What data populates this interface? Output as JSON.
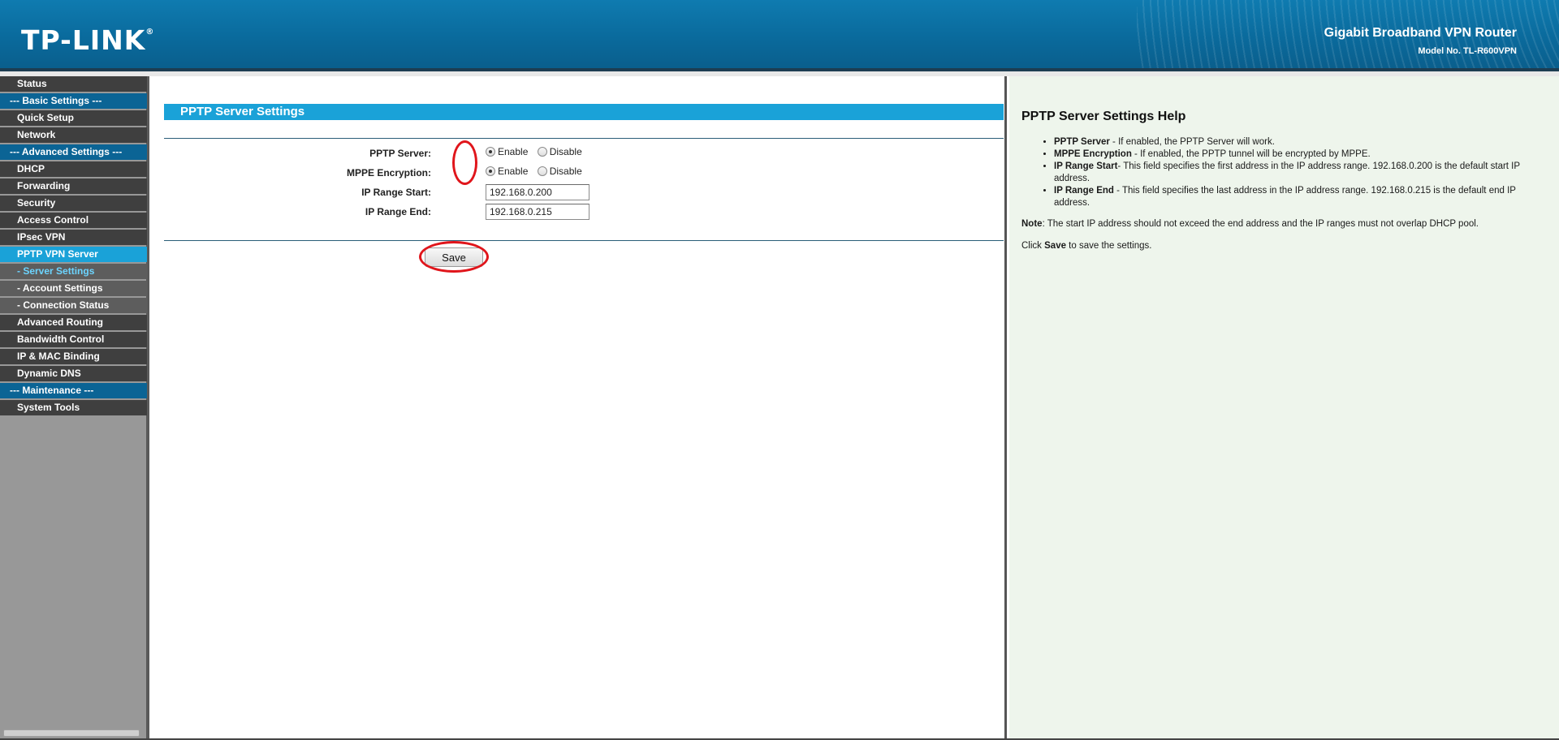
{
  "header": {
    "logo": "TP-LINK",
    "logo_mark": "®",
    "product_name": "Gigabit Broadband VPN Router",
    "model": "Model No. TL-R600VPN"
  },
  "sidebar": {
    "items": [
      {
        "label": "Status"
      },
      {
        "label": "--- Basic Settings ---"
      },
      {
        "label": "Quick Setup"
      },
      {
        "label": "Network"
      },
      {
        "label": "--- Advanced Settings ---"
      },
      {
        "label": "DHCP"
      },
      {
        "label": "Forwarding"
      },
      {
        "label": "Security"
      },
      {
        "label": "Access Control"
      },
      {
        "label": "IPsec VPN"
      },
      {
        "label": "PPTP VPN Server"
      },
      {
        "label": "- Server Settings"
      },
      {
        "label": "- Account Settings"
      },
      {
        "label": "- Connection Status"
      },
      {
        "label": "Advanced Routing"
      },
      {
        "label": "Bandwidth Control"
      },
      {
        "label": "IP & MAC Binding"
      },
      {
        "label": "Dynamic DNS"
      },
      {
        "label": "--- Maintenance ---"
      },
      {
        "label": "System Tools"
      }
    ]
  },
  "main": {
    "title": "PPTP Server Settings",
    "form": {
      "pptp_server": {
        "label": "PPTP Server:",
        "enable": "Enable",
        "disable": "Disable",
        "selected": "Enable"
      },
      "mppe": {
        "label": "MPPE Encryption:",
        "enable": "Enable",
        "disable": "Disable",
        "selected": "Enable"
      },
      "ip_start": {
        "label": "IP Range Start:",
        "value": "192.168.0.200"
      },
      "ip_end": {
        "label": "IP Range End:",
        "value": "192.168.0.215"
      }
    },
    "save_label": "Save"
  },
  "help": {
    "title": "PPTP Server Settings Help",
    "items": [
      {
        "term": "PPTP Server",
        "sep": " - ",
        "text": "If enabled, the PPTP Server will work."
      },
      {
        "term": "MPPE Encryption",
        "sep": " - ",
        "text": "If enabled, the PPTP tunnel will be encrypted by MPPE."
      },
      {
        "term": "IP Range Start",
        "sep": "- ",
        "text": "This field specifies the first address in the IP address range. 192.168.0.200 is the default start IP address."
      },
      {
        "term": "IP Range End",
        "sep": " - ",
        "text": "This field specifies the last address in the IP address range. 192.168.0.215 is the default end IP address."
      }
    ],
    "note_label": "Note",
    "note_text": ": The start IP address should not exceed the end address and the IP ranges must not overlap DHCP pool.",
    "click_prefix": "Click ",
    "click_bold": "Save",
    "click_suffix": " to save the settings."
  },
  "colors": {
    "annotation": "#e0151b",
    "accent": "#1aa2d8",
    "section": "#0b6495"
  }
}
